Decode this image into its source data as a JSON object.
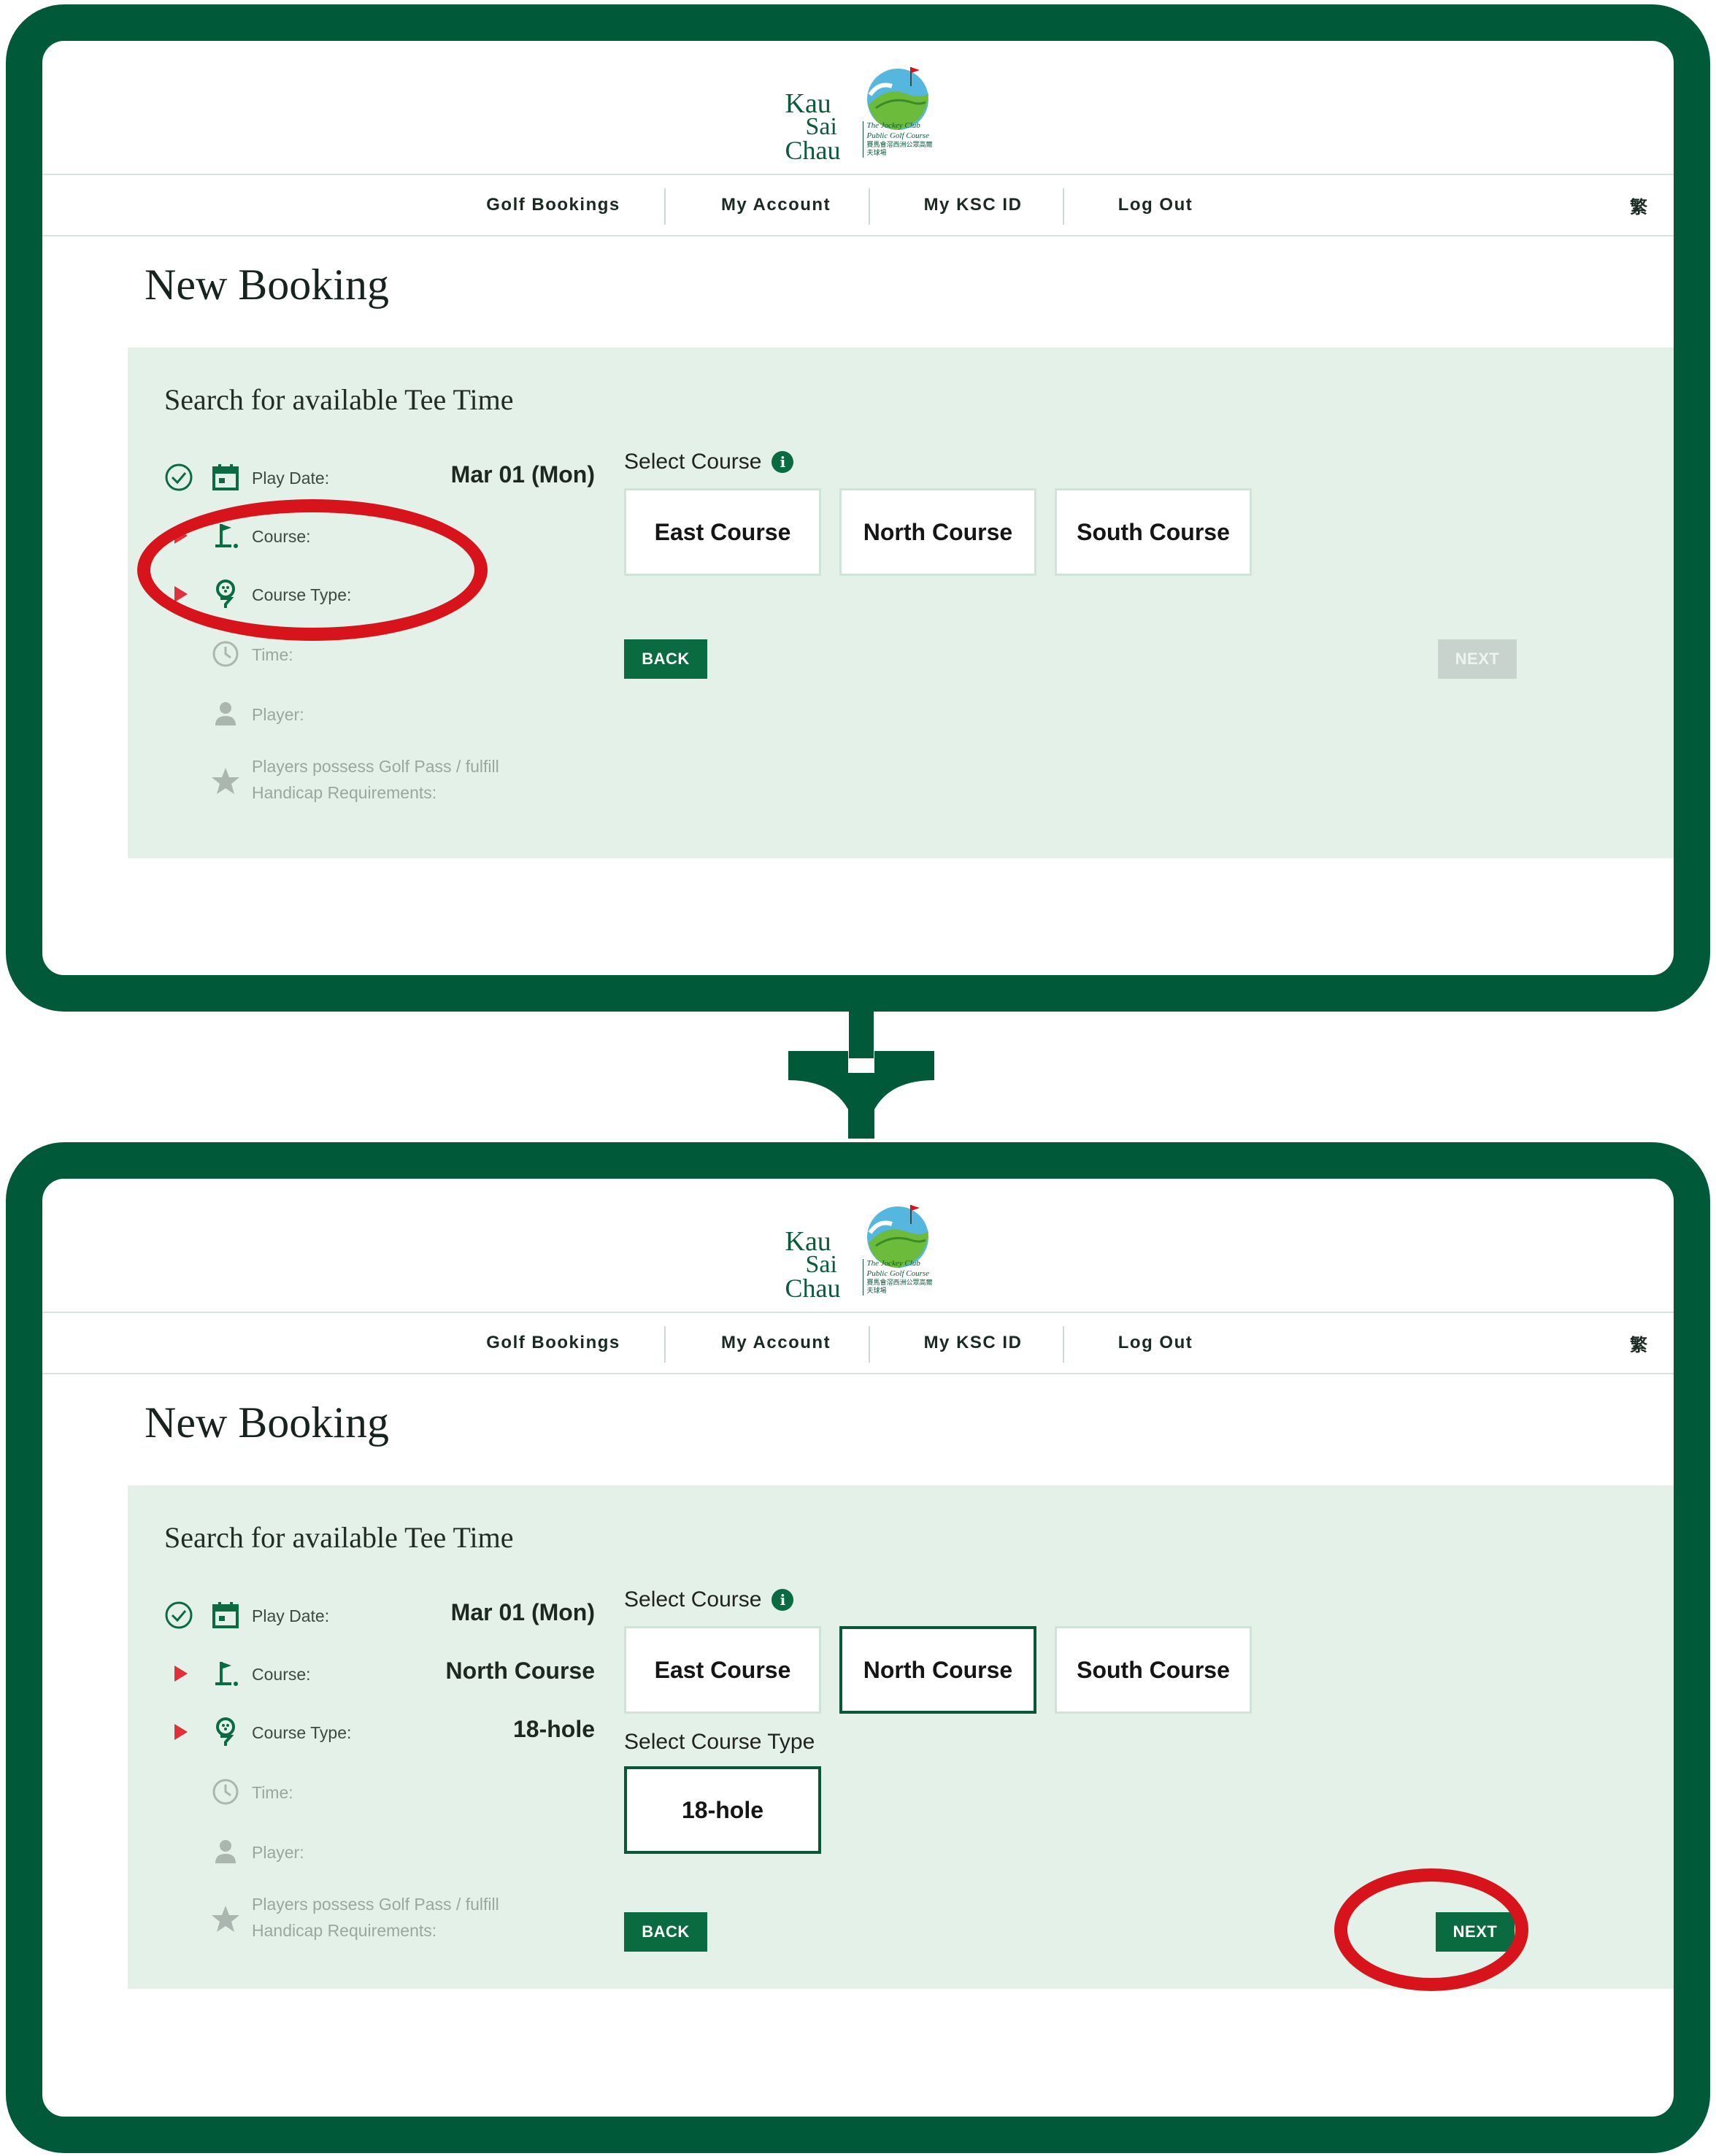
{
  "colors": {
    "frame": "#005a3a",
    "panel_bg": "#e4f1e8",
    "accent_green": "#0a6b40",
    "highlight_ring": "#d7141b",
    "disabled_button": "#c7d3cc"
  },
  "logo": {
    "line1": "Kau",
    "line2": "Sai",
    "line3": "Chau",
    "cjk": "滘西洲",
    "sub1": "The Jockey Club",
    "sub2": "Public Golf Course",
    "sub3": "賽馬會滘西洲公眾高爾夫球場"
  },
  "nav": {
    "items": [
      "Golf Bookings",
      "My Account",
      "My KSC ID",
      "Log Out"
    ],
    "lang": "繁"
  },
  "page_title": "New Booking",
  "panel_title": "Search for available Tee Time",
  "labels": {
    "play_date": "Play Date:",
    "course": "Course:",
    "course_type": "Course Type:",
    "time": "Time:",
    "player": "Player:",
    "golf_pass_1": "Players possess Golf Pass / fulfill",
    "golf_pass_2": "Handicap Requirements:",
    "select_course": "Select Course",
    "select_course_type": "Select Course Type",
    "info": "i"
  },
  "courses": [
    "East Course",
    "North Course",
    "South Course"
  ],
  "course_types": [
    "18-hole"
  ],
  "buttons": {
    "back": "BACK",
    "next": "NEXT"
  },
  "step1": {
    "play_date_value": "Mar 01 (Mon)",
    "selected_course": null,
    "next_enabled": false
  },
  "step2": {
    "play_date_value": "Mar 01 (Mon)",
    "course_value": "North Course",
    "course_type_value": "18-hole",
    "selected_course": "North Course",
    "next_enabled": true
  }
}
